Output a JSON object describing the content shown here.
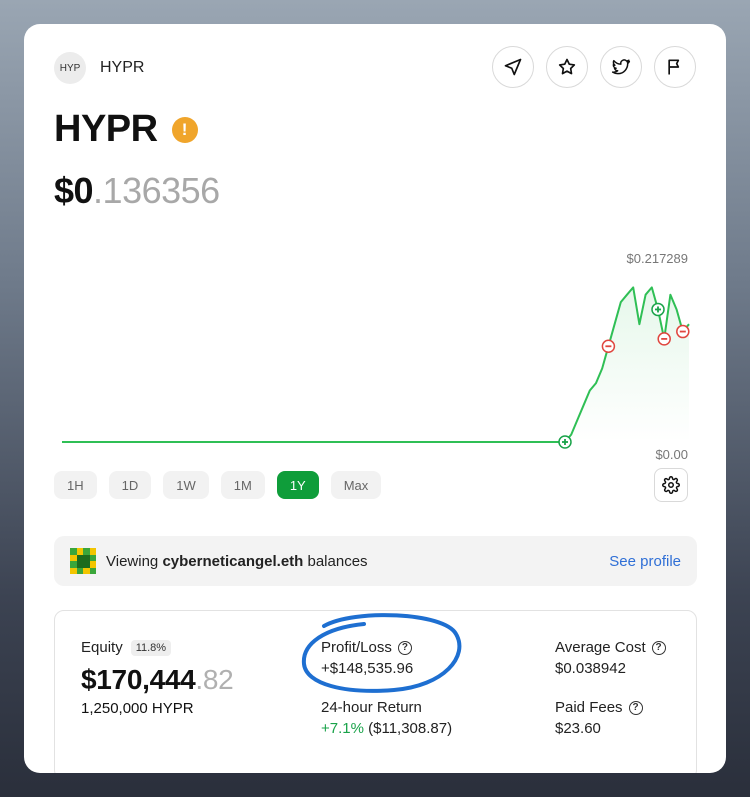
{
  "token": {
    "logo_text": "HYP",
    "name": "HYPR"
  },
  "header": {
    "title": "HYPR",
    "warning_symbol": "!"
  },
  "price": {
    "whole": "$0",
    "decimals": ".136356"
  },
  "chart_data": {
    "type": "line",
    "title": "",
    "max_label": "$0.217289",
    "min_label": "$0.00",
    "y_range": [
      0,
      0.217289
    ],
    "points": [
      0,
      0,
      0,
      0,
      0,
      0,
      0,
      0,
      0,
      0.01,
      0.03,
      0.05,
      0.07,
      0.08,
      0.1,
      0.13,
      0.16,
      0.19,
      0.2,
      0.21,
      0.16,
      0.2,
      0.21,
      0.18,
      0.14,
      0.2,
      0.18,
      0.15,
      0.16
    ],
    "markers": [
      {
        "type": "buy",
        "index": 8
      },
      {
        "type": "sell",
        "index": 15
      },
      {
        "type": "sell",
        "index": 24
      },
      {
        "type": "buy",
        "index": 23
      },
      {
        "type": "sell",
        "index": 27
      }
    ],
    "color": "#2fbf55"
  },
  "ranges": [
    "1H",
    "1D",
    "1W",
    "1M",
    "1Y",
    "Max"
  ],
  "active_range": "1Y",
  "banner": {
    "prefix": "Viewing",
    "account": "cyberneticangel.eth",
    "suffix": "balances",
    "link": "See profile"
  },
  "stats": {
    "equity_label": "Equity",
    "equity_badge": "11.8%",
    "equity_whole": "$170,444",
    "equity_decimals": ".82",
    "holding": "1,250,000 HYPR",
    "pnl_label": "Profit/Loss",
    "pnl_value": "+$148,535.96",
    "return_label": "24-hour Return",
    "return_pct": "+7.1%",
    "return_value": "($11,308.87)",
    "avg_cost_label": "Average Cost",
    "avg_cost_value": "$0.038942",
    "fees_label": "Paid Fees",
    "fees_value": "$23.60"
  },
  "colors": {
    "accent_green": "#0f9d3a",
    "link_blue": "#2f6fd6",
    "warning": "#f0a52b",
    "annotation": "#1e6fd1"
  }
}
